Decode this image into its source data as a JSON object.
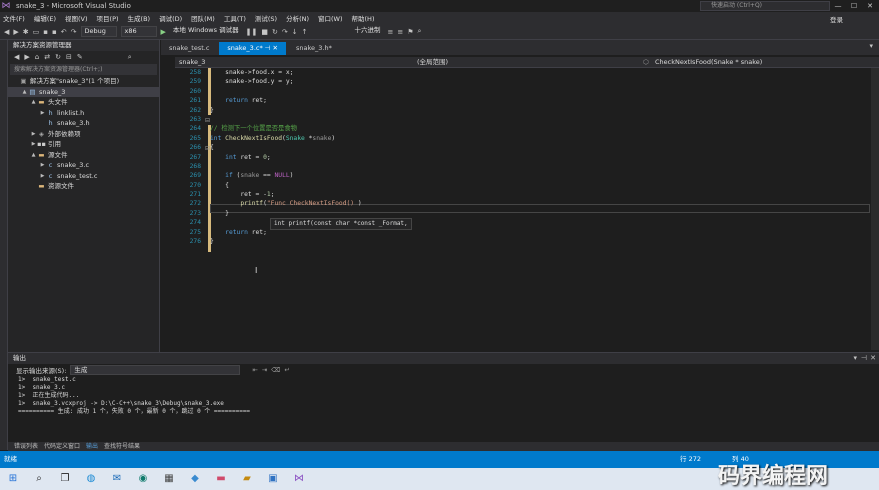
{
  "window": {
    "title": "snake_3 - Microsoft Visual Studio",
    "quick_launch_placeholder": "快速启动 (Ctrl+Q)",
    "login": "登录"
  },
  "menu": [
    "文件(F)",
    "编辑(E)",
    "视图(V)",
    "项目(P)",
    "生成(B)",
    "调试(D)",
    "团队(M)",
    "工具(T)",
    "测试(S)",
    "分析(N)",
    "窗口(W)",
    "帮助(H)"
  ],
  "toolbar": {
    "config": "Debug",
    "platform": "x86",
    "run": "本地 Windows 调试器",
    "hex": "十六进制"
  },
  "solution_explorer": {
    "title": "解决方案资源管理器",
    "search_placeholder": "搜索解决方案资源管理器(Ctrl+;)",
    "items": [
      {
        "label": "解决方案\"snake_3\"(1 个项目)",
        "level": 0,
        "icon": "solution-icon",
        "arrow": "",
        "sel": false
      },
      {
        "label": "snake_3",
        "level": 1,
        "icon": "project-icon",
        "arrow": "▲",
        "sel": true
      },
      {
        "label": "头文件",
        "level": 2,
        "icon": "folder-icon",
        "arrow": "▲",
        "sel": false
      },
      {
        "label": "linklist.h",
        "level": 3,
        "icon": "header-file-icon",
        "arrow": "▶",
        "sel": false
      },
      {
        "label": "snake_3.h",
        "level": 3,
        "icon": "header-file-icon",
        "arrow": "",
        "sel": false
      },
      {
        "label": "外部依赖项",
        "level": 2,
        "icon": "dependency-icon",
        "arrow": "▶",
        "sel": false
      },
      {
        "label": "引用",
        "level": 2,
        "icon": "reference-icon",
        "arrow": "▶",
        "sel": false
      },
      {
        "label": "源文件",
        "level": 2,
        "icon": "folder-icon",
        "arrow": "▲",
        "sel": false
      },
      {
        "label": "snake_3.c",
        "level": 3,
        "icon": "c-file-icon",
        "arrow": "▶",
        "sel": false
      },
      {
        "label": "snake_test.c",
        "level": 3,
        "icon": "c-file-icon",
        "arrow": "▶",
        "sel": false
      },
      {
        "label": "资源文件",
        "level": 2,
        "icon": "folder-icon",
        "arrow": "",
        "sel": false
      }
    ]
  },
  "tabs": [
    {
      "label": "snake_test.c",
      "active": false
    },
    {
      "label": "snake_3.c*",
      "active": true
    },
    {
      "label": "snake_3.h*",
      "active": false
    }
  ],
  "navbar": {
    "project": "snake_3",
    "scope": "(全局范围)",
    "function": "CheckNextIsFood(Snake * snake)"
  },
  "editor": {
    "line_numbers": [
      "258",
      "259",
      "260",
      "261",
      "262",
      "263",
      "264",
      "265",
      "266",
      "267",
      "268",
      "269",
      "270",
      "271",
      "272",
      "273",
      "274",
      "275",
      "276"
    ],
    "tooltip": "int printf(const char *const _Format, ...)"
  },
  "output": {
    "title": "输出",
    "source_label": "显示输出来源(S):",
    "source_value": "生成",
    "lines": [
      "1>  snake_test.c",
      "1>  snake_3.c",
      "1>  正在生成代码...",
      "1>  snake_3.vcxproj -> D:\\C-C++\\snake_3\\Debug\\snake_3.exe",
      "========== 生成: 成功 1 个，失败 0 个，最新 0 个，跳过 0 个 =========="
    ]
  },
  "bottom_tabs": [
    "错误列表",
    "代码定义窗口",
    "输出",
    "查找符号结果"
  ],
  "status": {
    "left": "就绪",
    "line": "行 272",
    "col": "列 40"
  },
  "watermark": "码界编程网",
  "colors": {
    "accent": "#007acc",
    "background": "#1e1e1e",
    "keyword": "#569cd6",
    "comment": "#57a64a"
  }
}
